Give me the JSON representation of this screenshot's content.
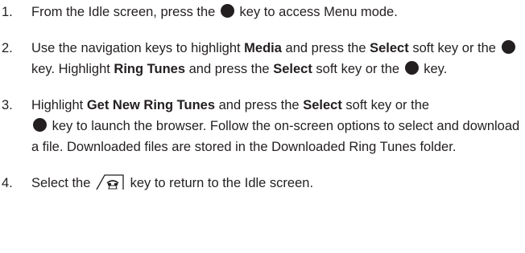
{
  "steps": [
    {
      "number": "1.",
      "t1": "From the Idle screen, press the",
      "t2": "key to access Menu mode."
    },
    {
      "number": "2.",
      "t1": "Use the navigation keys to highlight",
      "b1": "Media",
      "t2": "and press the",
      "b2": "Select",
      "t3": "soft key or the",
      "t4": "key. Highlight",
      "b3": "Ring Tunes",
      "t5": "and press the",
      "b4": "Select",
      "t6": "soft key or the",
      "t7": "key."
    },
    {
      "number": "3.",
      "t1": "Highlight",
      "b1": "Get New Ring Tunes",
      "t2": "and press the",
      "b2": "Select",
      "t3": "soft key or the",
      "t4": "key to launch the browser. Follow the on-screen options to select and download a file. Downloaded files are stored in the Downloaded Ring Tunes folder."
    },
    {
      "number": "4.",
      "t1": "Select the",
      "t2": "key to return to the Idle screen."
    }
  ],
  "icons": {
    "ok_key": "ok-key-icon",
    "end_key": "end-key-icon"
  }
}
